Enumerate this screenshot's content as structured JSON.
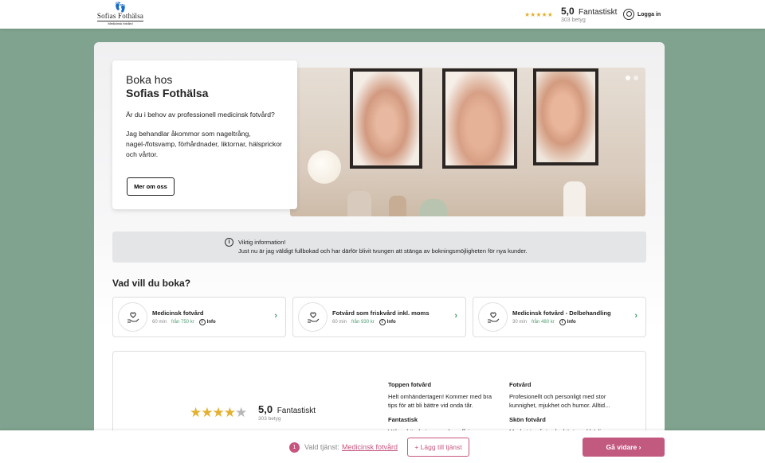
{
  "header": {
    "logo_name": "Sofias Fothälsa",
    "logo_tagline": "Medicinsk fotvård",
    "rating_stars": "★★★★★",
    "rating_score": "5,0",
    "rating_word": "Fantastiskt",
    "rating_count": "303 betyg",
    "login_label": "Logga in"
  },
  "hero": {
    "title_line1": "Boka hos",
    "title_line2": "Sofias Fothälsa",
    "question": "Är du i behov av professionell medicinsk fotvård?",
    "description": "Jag behandlar åkommor som nageltrång, nagel-/fotsvamp, förhårdnader, liktornar, hälsprickor och vårtor.",
    "more_button": "Mer om oss"
  },
  "notice": {
    "title": "Viktig information!",
    "text": "Just nu är jag väldigt fullbokad och har därför blivit tvungen att stänga av bokningsmöjligheten för nya kunder."
  },
  "services": {
    "heading": "Vad vill du boka?",
    "items": [
      {
        "name": "Medicinsk fotvård",
        "duration": "60 min",
        "price": "från 750 kr",
        "info": "Info"
      },
      {
        "name": "Fotvård som friskvård inkl. moms",
        "duration": "60 min",
        "price": "från 930 kr",
        "info": "Info"
      },
      {
        "name": "Medicinsk fotvård - Delbehandling",
        "duration": "30 min",
        "price": "från 480 kr",
        "info": "Info"
      }
    ]
  },
  "reviews": {
    "score": "5,0",
    "word": "Fantastiskt",
    "count": "303 betyg",
    "stars_full": "★★★★",
    "stars_half": "★",
    "items": [
      {
        "title": "Toppen fotvård",
        "text": "Helt omhändertagen! Kommer med bra tips för att bli bättre vid onda tår."
      },
      {
        "title": "Fotvård",
        "text": "Profesionellt och personligt med stor kunnighet, mjukhet och humor. Alltid..."
      },
      {
        "title": "Fantastisk",
        "text": "Väl omhändertagen och proffsig"
      },
      {
        "title": "Skön fotvård",
        "text": "Mycket trevligt och skönt med härlig"
      }
    ]
  },
  "bottom": {
    "step": "1",
    "selected_label": "Vald tjänst:",
    "selected_value": "Medicinsk fotvård",
    "add_button": "+ Lägg till tjänst",
    "next_button": "Gå vidare ›"
  },
  "colors": {
    "background": "#7fa38e",
    "accent": "#c25a80",
    "price_green": "#4b9c6f",
    "star": "#e3b12f"
  }
}
